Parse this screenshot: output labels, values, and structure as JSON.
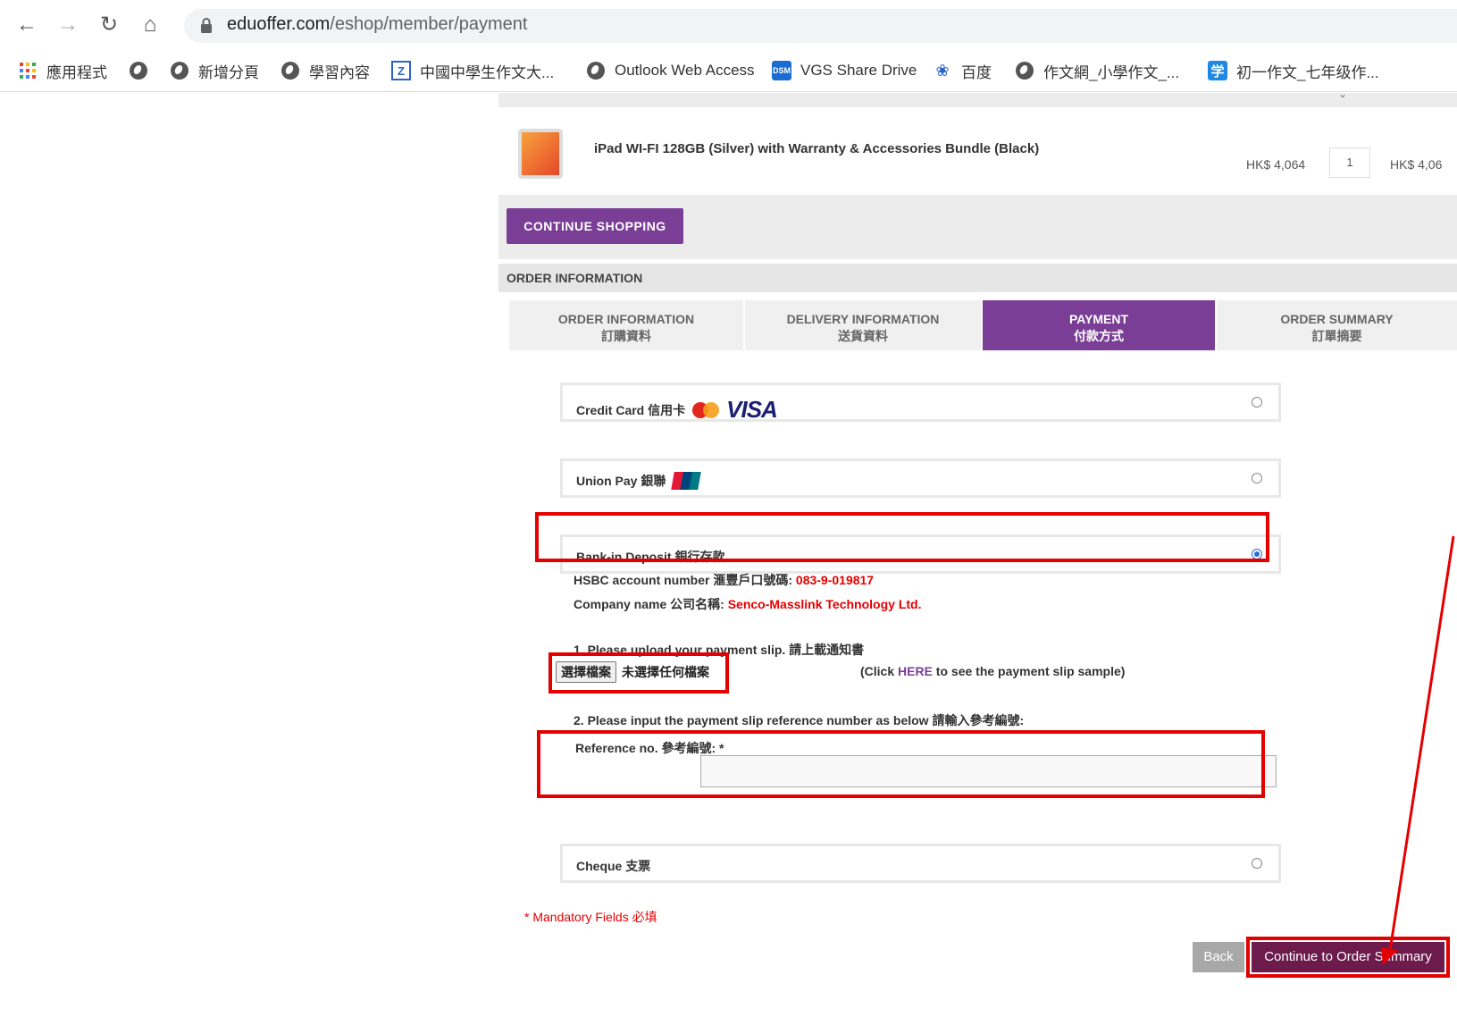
{
  "browser": {
    "url_host": "eduoffer.com",
    "url_path": "/eshop/member/payment",
    "bookmarks": [
      {
        "label": "應用程式",
        "icon": "apps-grid-icon"
      },
      {
        "label": "",
        "icon": "globe-icon"
      },
      {
        "label": "新增分頁",
        "icon": "globe-icon"
      },
      {
        "label": "學習內容",
        "icon": "globe-icon"
      },
      {
        "label": "中國中學生作文大...",
        "icon": "z-icon"
      },
      {
        "label": "Outlook Web Access",
        "icon": "globe-icon"
      },
      {
        "label": "VGS Share Drive",
        "icon": "dsm-icon"
      },
      {
        "label": "百度",
        "icon": "paw-icon"
      },
      {
        "label": "作文網_小學作文_...",
        "icon": "globe-icon"
      },
      {
        "label": "初一作文_七年级作...",
        "icon": "xue-icon"
      }
    ]
  },
  "cart": {
    "item_name": "iPad WI-FI 128GB (Silver) with Warranty & Accessories Bundle (Black)",
    "price": "HK$ 4,064",
    "qty": "1",
    "total": "HK$ 4,06"
  },
  "continue_shopping_label": "CONTINUE SHOPPING",
  "section_title": "ORDER INFORMATION",
  "tabs": [
    {
      "en": "ORDER INFORMATION",
      "zh": "訂購資料",
      "active": false
    },
    {
      "en": "DELIVERY INFORMATION",
      "zh": "送貨資料",
      "active": false
    },
    {
      "en": "PAYMENT",
      "zh": "付款方式",
      "active": true
    },
    {
      "en": "ORDER SUMMARY",
      "zh": "訂單摘要",
      "active": false
    }
  ],
  "payment_methods": [
    {
      "label": "Credit Card 信用卡",
      "selected": false
    },
    {
      "label": "Union Pay 銀聯",
      "selected": false
    },
    {
      "label": "Bank-in Deposit 銀行存款",
      "selected": true
    },
    {
      "label": "Cheque 支票",
      "selected": false
    }
  ],
  "visa_text": "VISA",
  "bank": {
    "account_label": "HSBC account number 滙豐戶口號碼: ",
    "account_number": "083-9-019817",
    "company_label": "Company name 公司名稱: ",
    "company_name": "Senco-Masslink Technology Ltd.",
    "upload_instruction": "1. Please upload your payment slip. 請上載通知書",
    "file_button": "選擇檔案",
    "file_none": "未選擇任何檔案",
    "sample_prefix": "(Click ",
    "sample_link": "HERE",
    "sample_suffix": " to see the payment slip sample)",
    "ref_instruction": "2. Please input the payment slip reference number as below 請輸入參考編號:",
    "ref_label": "Reference no. 參考編號: *"
  },
  "mandatory_note": "* Mandatory Fields 必填",
  "buttons": {
    "back": "Back",
    "continue": "Continue to Order Summary"
  },
  "colors": {
    "brand_purple": "#7b3e96",
    "annotation_red": "#e40000",
    "continue_button": "#6d1a4d"
  }
}
